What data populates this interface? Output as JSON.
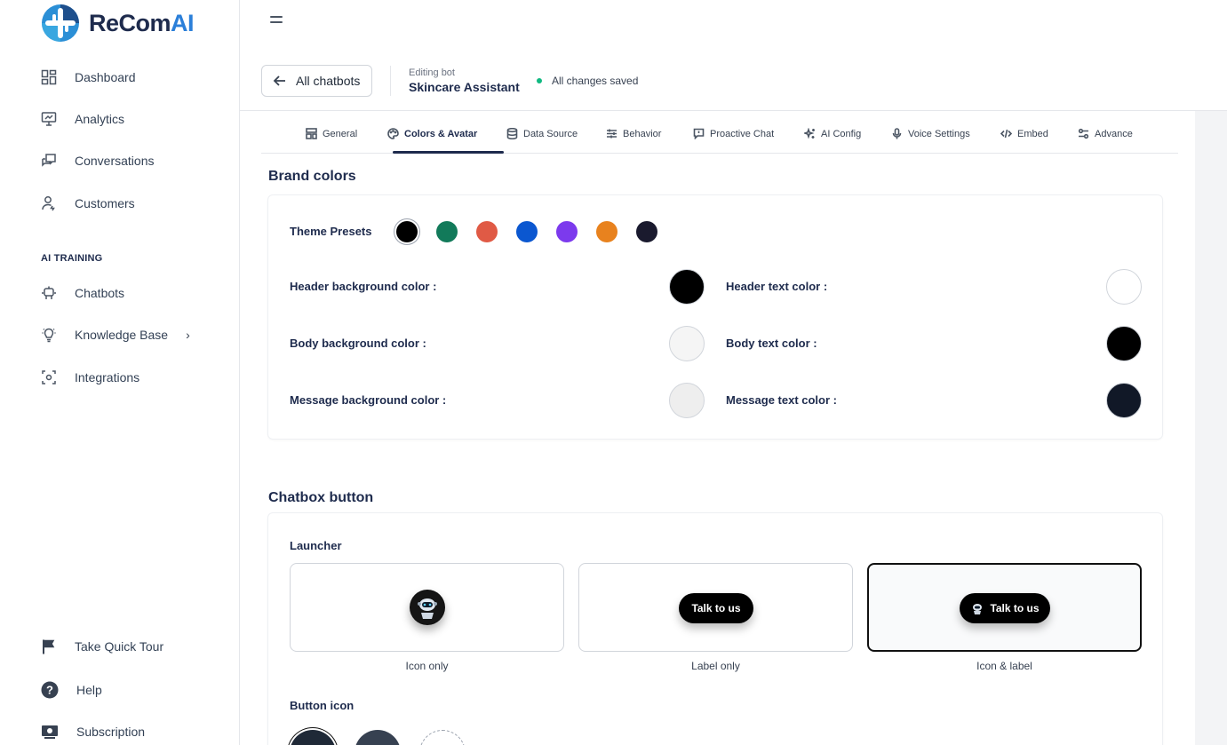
{
  "brand": {
    "name_main": "ReCom",
    "name_accent": "AI"
  },
  "sidebar": {
    "items": [
      {
        "label": "Dashboard",
        "icon": "grid-icon"
      },
      {
        "label": "Analytics",
        "icon": "monitor-chart-icon"
      },
      {
        "label": "Conversations",
        "icon": "chat-icon"
      },
      {
        "label": "Customers",
        "icon": "user-icon"
      }
    ],
    "section_label": "AI TRAINING",
    "training_items": [
      {
        "label": "Chatbots",
        "icon": "robot-icon"
      },
      {
        "label": "Knowledge Base",
        "icon": "lightbulb-icon"
      },
      {
        "label": "Integrations",
        "icon": "integrations-icon"
      }
    ],
    "footer_items": [
      {
        "label": "Take Quick Tour",
        "icon": "flag-icon"
      },
      {
        "label": "Help",
        "icon": "help-icon"
      },
      {
        "label": "Subscription",
        "icon": "subscription-icon"
      }
    ]
  },
  "header": {
    "back_label": "All chatbots",
    "editing_caption": "Editing bot",
    "bot_name": "Skincare Assistant",
    "save_status": "All changes saved"
  },
  "tabs": [
    {
      "label": "General",
      "icon": "general-icon"
    },
    {
      "label": "Colors & Avatar",
      "icon": "palette-icon",
      "active": true
    },
    {
      "label": "Data Source",
      "icon": "database-icon"
    },
    {
      "label": "Behavior",
      "icon": "sliders-icon"
    },
    {
      "label": "Proactive Chat",
      "icon": "message-icon"
    },
    {
      "label": "AI Config",
      "icon": "sparkle-icon"
    },
    {
      "label": "Voice Settings",
      "icon": "mic-icon"
    },
    {
      "label": "Embed",
      "icon": "code-icon"
    },
    {
      "label": "Advance",
      "icon": "settings-icon"
    }
  ],
  "brand_colors": {
    "title": "Brand colors",
    "presets_label": "Theme Presets",
    "presets": [
      "#000000",
      "#127a5a",
      "#e05a45",
      "#0b57d0",
      "#7c3aed",
      "#e8821e",
      "#1a1a2e"
    ],
    "fields": [
      {
        "label": "Header background color :",
        "color": "#000000"
      },
      {
        "label": "Header text color :",
        "color": "#ffffff"
      },
      {
        "label": "Body background color :",
        "color": "#f5f5f5"
      },
      {
        "label": "Body text color :",
        "color": "#000000"
      },
      {
        "label": "Message background color :",
        "color": "#eeeeee"
      },
      {
        "label": "Message text color :",
        "color": "#111827"
      }
    ]
  },
  "chatbox_button": {
    "title": "Chatbox button",
    "launcher_label": "Launcher",
    "launcher_options": [
      {
        "caption": "Icon only"
      },
      {
        "caption": "Label only",
        "pill_text": "Talk to us"
      },
      {
        "caption": "Icon & label",
        "pill_text": "Talk to us",
        "selected": true
      }
    ],
    "button_icon_label": "Button icon"
  }
}
